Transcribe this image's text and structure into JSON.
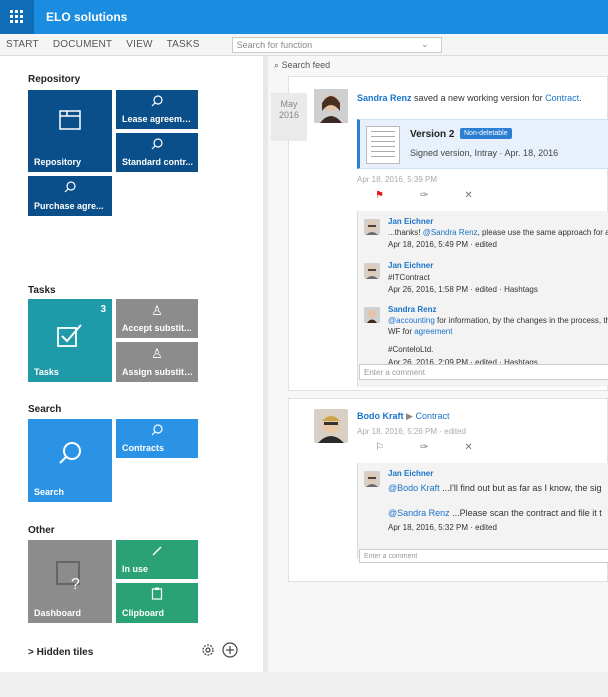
{
  "app": {
    "title": "ELO solutions"
  },
  "menu": {
    "items": [
      "START",
      "DOCUMENT",
      "VIEW",
      "TASKS"
    ],
    "function_search_placeholder": "Search for function"
  },
  "sidebar": {
    "repository": {
      "heading": "Repository",
      "tiles": {
        "repository": "Repository",
        "lease": "Lease agreement",
        "standard": "Standard contr...",
        "purchase": "Purchase agre..."
      }
    },
    "tasks": {
      "heading": "Tasks",
      "tiles": {
        "tasks": "Tasks",
        "tasks_count": "3",
        "accept": "Accept substit...",
        "assign": "Assign substitu..."
      }
    },
    "search": {
      "heading": "Search",
      "tiles": {
        "search": "Search",
        "contracts": "Contracts"
      }
    },
    "other": {
      "heading": "Other",
      "tiles": {
        "dashboard": "Dashboard",
        "inuse": "In use",
        "clipboard": "Clipboard"
      }
    },
    "hidden_tiles": "> Hidden tiles"
  },
  "feed": {
    "search_placeholder": "Search feed",
    "post1": {
      "date_month": "May",
      "date_year": "2016",
      "author": "Sandra Renz",
      "action": "saved a new working version for",
      "target": "Contract",
      "target_suffix": ".",
      "doc_version": "Version 2",
      "doc_badge": "Non-deletable",
      "doc_signed": "Signed version, Intray · Apr. 18, 2016",
      "timestamp": "Apr 18, 2016, 5:39 PM",
      "comments": [
        {
          "author": "Jan Eichner",
          "prefix": "...thanks!",
          "mention": "@Sandra Renz",
          "text": ", please use the same approach for all c",
          "meta": "Apr 18, 2016, 5:49 PM · edited"
        },
        {
          "author": "Jan Eichner",
          "hashtag": "#ITContract",
          "meta": "Apr 26, 2016, 1:58 PM · edited · Hashtags"
        },
        {
          "author": "Sandra Renz",
          "mention": "@accounting",
          "text": " for information, by the changes in the process, the v",
          "line2_prefix": "WF for",
          "line2_link": "agreement",
          "hashtag": "#ConteloLtd.",
          "meta": "Apr 26, 2016, 2:09 PM · edited · Hashtags"
        }
      ],
      "comment_placeholder": "Enter a comment"
    },
    "post2": {
      "author": "Bodo Kraft",
      "arrow": "▶",
      "target": "Contract",
      "timestamp": "Apr 18, 2016, 5:26 PM · edited",
      "comment": {
        "author": "Jan Eichner",
        "mention1": "@Bodo Kraft",
        "text1": " ...I'll find out but as far as I know, the sig",
        "mention2": "@Sandra Renz",
        "text2": " ...Please scan the contract and file it t",
        "meta": "Apr 18, 2016, 5:32 PM · edited"
      },
      "comment_placeholder": "Enter a comment"
    }
  },
  "icons": [
    "app-grid-icon",
    "search-icon",
    "window-icon",
    "check-icon",
    "substitute-icon",
    "gear-icon",
    "plus-circle-icon",
    "flag-icon",
    "pin-icon",
    "close-icon",
    "pencil-icon",
    "clipboard-icon",
    "dashboard-icon"
  ],
  "colors": {
    "topbar": "#1a8de0",
    "tile_blue": "#0b4f8a",
    "tile_teal": "#1f9aa9",
    "tile_grey": "#8c8c8c",
    "tile_sky": "#2b93e6",
    "tile_green": "#2aa276",
    "link": "#1a73c9"
  }
}
